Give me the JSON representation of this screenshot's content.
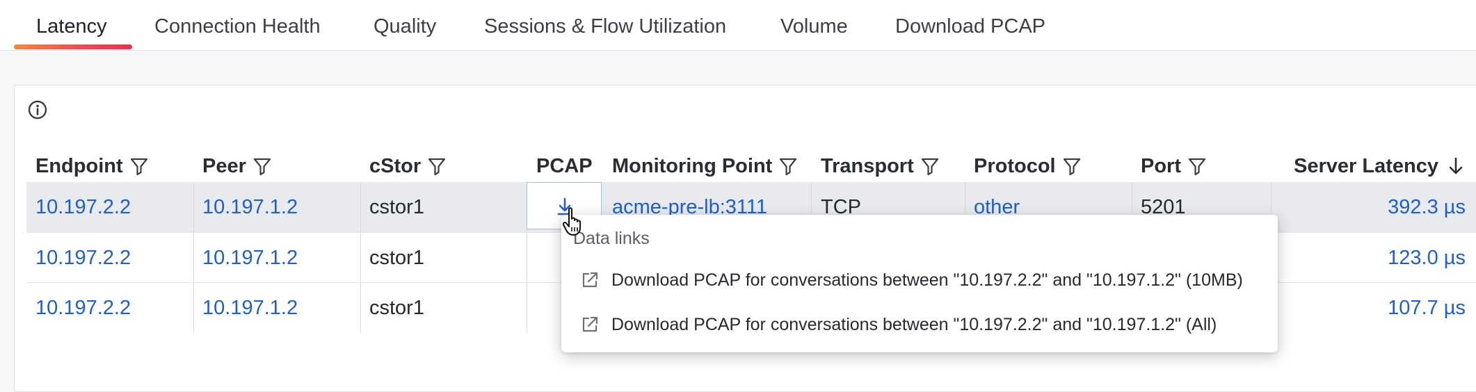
{
  "tabs": [
    {
      "label": "Latency",
      "active": true
    },
    {
      "label": "Connection Health"
    },
    {
      "label": "Quality"
    },
    {
      "label": "Sessions & Flow Utilization"
    },
    {
      "label": "Volume"
    },
    {
      "label": "Download PCAP"
    }
  ],
  "table": {
    "columns": [
      "Endpoint",
      "Peer",
      "cStor",
      "PCAP",
      "Monitoring Point",
      "Transport",
      "Protocol",
      "Port",
      "Server Latency"
    ],
    "sort": {
      "column": "Server Latency",
      "direction": "descending"
    },
    "rows": [
      {
        "endpoint": "10.197.2.2",
        "peer": "10.197.1.2",
        "cstor": "cstor1",
        "monitoring_point": "acme-pre-lb:3111",
        "transport": "TCP",
        "protocol": "other",
        "port": "5201",
        "server_latency": "392.3 µs"
      },
      {
        "endpoint": "10.197.2.2",
        "peer": "10.197.1.2",
        "cstor": "cstor1",
        "server_latency": "123.0 µs"
      },
      {
        "endpoint": "10.197.2.2",
        "peer": "10.197.1.2",
        "cstor": "cstor1",
        "server_latency": "107.7 µs"
      }
    ]
  },
  "popup": {
    "title": "Data links",
    "items": [
      {
        "label": "Download PCAP for conversations between \"10.197.2.2\" and \"10.197.1.2\" (10MB)"
      },
      {
        "label": "Download PCAP for conversations between \"10.197.2.2\" and \"10.197.1.2\" (All)"
      }
    ]
  },
  "colors": {
    "accent_start": "#f28a3a",
    "accent_end": "#e8304f",
    "link": "#1d5fd1"
  },
  "icons": [
    "info-icon",
    "filter-icon",
    "sort-down-arrow-icon",
    "download-icon",
    "hand-cursor-icon",
    "external-link-icon"
  ]
}
